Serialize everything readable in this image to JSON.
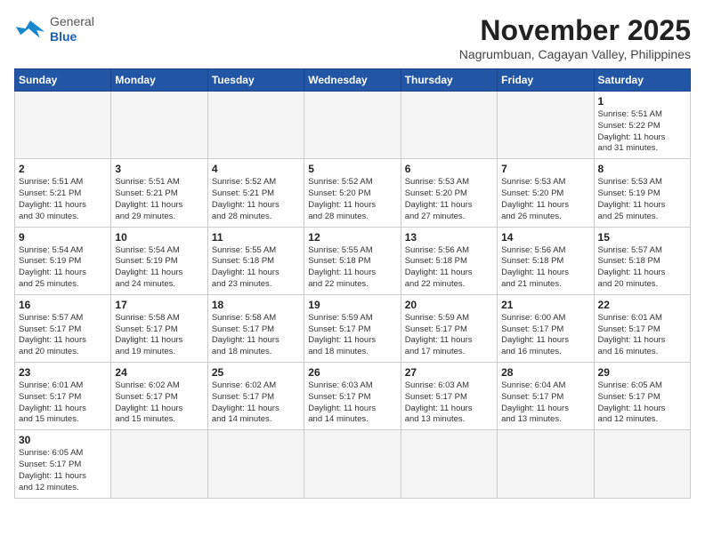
{
  "header": {
    "logo_general": "General",
    "logo_blue": "Blue",
    "month_year": "November 2025",
    "location": "Nagrumbuan, Cagayan Valley, Philippines"
  },
  "weekdays": [
    "Sunday",
    "Monday",
    "Tuesday",
    "Wednesday",
    "Thursday",
    "Friday",
    "Saturday"
  ],
  "weeks": [
    [
      {
        "day": "",
        "info": ""
      },
      {
        "day": "",
        "info": ""
      },
      {
        "day": "",
        "info": ""
      },
      {
        "day": "",
        "info": ""
      },
      {
        "day": "",
        "info": ""
      },
      {
        "day": "",
        "info": ""
      },
      {
        "day": "1",
        "info": "Sunrise: 5:51 AM\nSunset: 5:22 PM\nDaylight: 11 hours\nand 31 minutes."
      }
    ],
    [
      {
        "day": "2",
        "info": "Sunrise: 5:51 AM\nSunset: 5:21 PM\nDaylight: 11 hours\nand 30 minutes."
      },
      {
        "day": "3",
        "info": "Sunrise: 5:51 AM\nSunset: 5:21 PM\nDaylight: 11 hours\nand 29 minutes."
      },
      {
        "day": "4",
        "info": "Sunrise: 5:52 AM\nSunset: 5:21 PM\nDaylight: 11 hours\nand 28 minutes."
      },
      {
        "day": "5",
        "info": "Sunrise: 5:52 AM\nSunset: 5:20 PM\nDaylight: 11 hours\nand 28 minutes."
      },
      {
        "day": "6",
        "info": "Sunrise: 5:53 AM\nSunset: 5:20 PM\nDaylight: 11 hours\nand 27 minutes."
      },
      {
        "day": "7",
        "info": "Sunrise: 5:53 AM\nSunset: 5:20 PM\nDaylight: 11 hours\nand 26 minutes."
      },
      {
        "day": "8",
        "info": "Sunrise: 5:53 AM\nSunset: 5:19 PM\nDaylight: 11 hours\nand 25 minutes."
      }
    ],
    [
      {
        "day": "9",
        "info": "Sunrise: 5:54 AM\nSunset: 5:19 PM\nDaylight: 11 hours\nand 25 minutes."
      },
      {
        "day": "10",
        "info": "Sunrise: 5:54 AM\nSunset: 5:19 PM\nDaylight: 11 hours\nand 24 minutes."
      },
      {
        "day": "11",
        "info": "Sunrise: 5:55 AM\nSunset: 5:18 PM\nDaylight: 11 hours\nand 23 minutes."
      },
      {
        "day": "12",
        "info": "Sunrise: 5:55 AM\nSunset: 5:18 PM\nDaylight: 11 hours\nand 22 minutes."
      },
      {
        "day": "13",
        "info": "Sunrise: 5:56 AM\nSunset: 5:18 PM\nDaylight: 11 hours\nand 22 minutes."
      },
      {
        "day": "14",
        "info": "Sunrise: 5:56 AM\nSunset: 5:18 PM\nDaylight: 11 hours\nand 21 minutes."
      },
      {
        "day": "15",
        "info": "Sunrise: 5:57 AM\nSunset: 5:18 PM\nDaylight: 11 hours\nand 20 minutes."
      }
    ],
    [
      {
        "day": "16",
        "info": "Sunrise: 5:57 AM\nSunset: 5:17 PM\nDaylight: 11 hours\nand 20 minutes."
      },
      {
        "day": "17",
        "info": "Sunrise: 5:58 AM\nSunset: 5:17 PM\nDaylight: 11 hours\nand 19 minutes."
      },
      {
        "day": "18",
        "info": "Sunrise: 5:58 AM\nSunset: 5:17 PM\nDaylight: 11 hours\nand 18 minutes."
      },
      {
        "day": "19",
        "info": "Sunrise: 5:59 AM\nSunset: 5:17 PM\nDaylight: 11 hours\nand 18 minutes."
      },
      {
        "day": "20",
        "info": "Sunrise: 5:59 AM\nSunset: 5:17 PM\nDaylight: 11 hours\nand 17 minutes."
      },
      {
        "day": "21",
        "info": "Sunrise: 6:00 AM\nSunset: 5:17 PM\nDaylight: 11 hours\nand 16 minutes."
      },
      {
        "day": "22",
        "info": "Sunrise: 6:01 AM\nSunset: 5:17 PM\nDaylight: 11 hours\nand 16 minutes."
      }
    ],
    [
      {
        "day": "23",
        "info": "Sunrise: 6:01 AM\nSunset: 5:17 PM\nDaylight: 11 hours\nand 15 minutes."
      },
      {
        "day": "24",
        "info": "Sunrise: 6:02 AM\nSunset: 5:17 PM\nDaylight: 11 hours\nand 15 minutes."
      },
      {
        "day": "25",
        "info": "Sunrise: 6:02 AM\nSunset: 5:17 PM\nDaylight: 11 hours\nand 14 minutes."
      },
      {
        "day": "26",
        "info": "Sunrise: 6:03 AM\nSunset: 5:17 PM\nDaylight: 11 hours\nand 14 minutes."
      },
      {
        "day": "27",
        "info": "Sunrise: 6:03 AM\nSunset: 5:17 PM\nDaylight: 11 hours\nand 13 minutes."
      },
      {
        "day": "28",
        "info": "Sunrise: 6:04 AM\nSunset: 5:17 PM\nDaylight: 11 hours\nand 13 minutes."
      },
      {
        "day": "29",
        "info": "Sunrise: 6:05 AM\nSunset: 5:17 PM\nDaylight: 11 hours\nand 12 minutes."
      }
    ],
    [
      {
        "day": "30",
        "info": "Sunrise: 6:05 AM\nSunset: 5:17 PM\nDaylight: 11 hours\nand 12 minutes."
      },
      {
        "day": "",
        "info": ""
      },
      {
        "day": "",
        "info": ""
      },
      {
        "day": "",
        "info": ""
      },
      {
        "day": "",
        "info": ""
      },
      {
        "day": "",
        "info": ""
      },
      {
        "day": "",
        "info": ""
      }
    ]
  ]
}
